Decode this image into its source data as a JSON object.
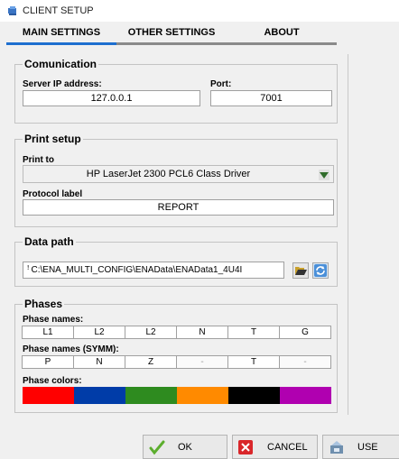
{
  "window": {
    "title": "CLIENT SETUP"
  },
  "tabs": [
    {
      "label": "MAIN SETTINGS",
      "active": true
    },
    {
      "label": "OTHER SETTINGS",
      "active": false
    },
    {
      "label": "ABOUT",
      "active": false
    }
  ],
  "communication": {
    "legend": "Comunication",
    "server_ip_label": "Server IP address:",
    "server_ip_value": "127.0.0.1",
    "port_label": "Port:",
    "port_value": "7001"
  },
  "print_setup": {
    "legend": "Print setup",
    "print_to_label": "Print to",
    "print_to_value": "HP LaserJet 2300 PCL6 Class Driver",
    "protocol_label": "Protocol label",
    "protocol_value": "REPORT"
  },
  "data_path": {
    "legend": "Data path",
    "path_value": "C:\\ENA_MULTI_CONFIG\\ENAData\\ENAData1_4U4I"
  },
  "phases": {
    "legend": "Phases",
    "names_label": "Phase names:",
    "names": [
      "L1",
      "L2",
      "L2",
      "N",
      "T",
      "G"
    ],
    "symm_label": "Phase names (SYMM):",
    "symm": [
      "P",
      "N",
      "Z",
      "-",
      "T",
      "-"
    ],
    "colors_label": "Phase colors:",
    "colors": [
      "#ff0000",
      "#003ca8",
      "#2e8b1f",
      "#ff8a00",
      "#000000",
      "#b000b0"
    ]
  },
  "buttons": {
    "ok": "OK",
    "cancel": "CANCEL",
    "use": "USE"
  },
  "accent_color": "#1e6fd0"
}
